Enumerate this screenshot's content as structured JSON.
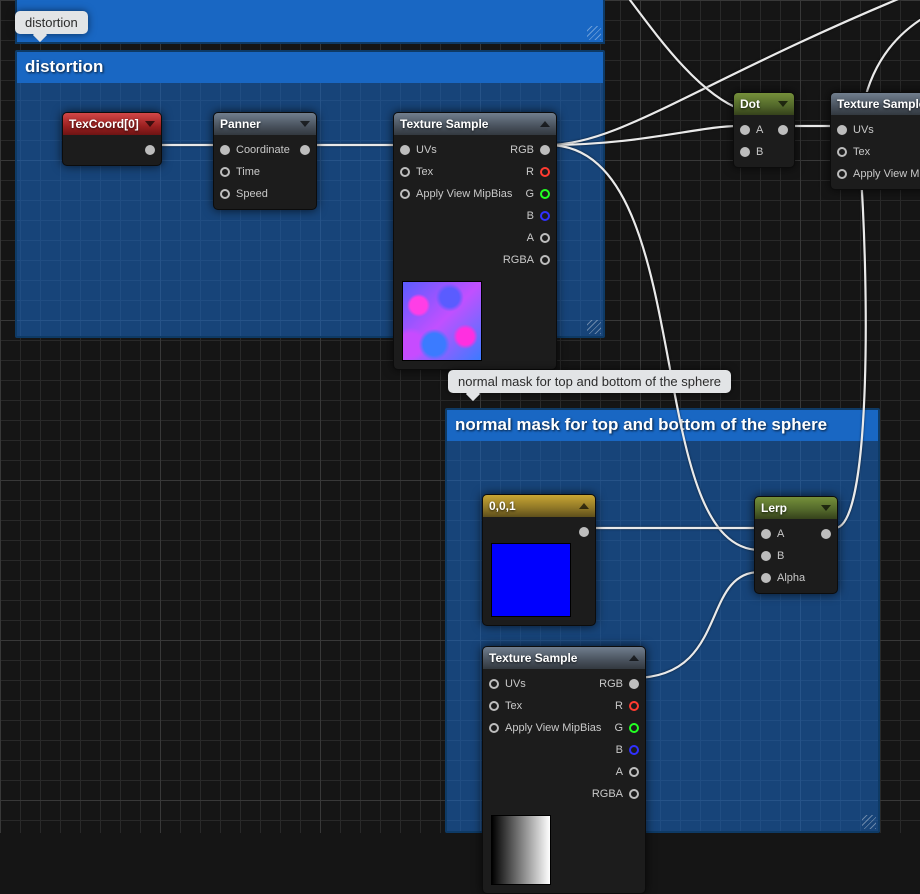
{
  "tooltips": {
    "distortion": "distortion",
    "mask": "normal mask for top and bottom of the sphere"
  },
  "comments": {
    "distortion": "distortion",
    "mask": "normal mask for top and bottom of the sphere"
  },
  "nodes": {
    "texcoord": {
      "title": "TexCoord[0]"
    },
    "panner": {
      "title": "Panner",
      "in": [
        "Coordinate",
        "Time",
        "Speed"
      ]
    },
    "texsample": {
      "title": "Texture Sample",
      "in": [
        "UVs",
        "Tex",
        "Apply View MipBias"
      ],
      "out": [
        "RGB",
        "R",
        "G",
        "B",
        "A",
        "RGBA"
      ]
    },
    "dot": {
      "title": "Dot",
      "in": [
        "A",
        "B"
      ]
    },
    "texsample2": {
      "title": "Texture Sample",
      "in": [
        "UVs",
        "Tex",
        "Apply View MipBi"
      ]
    },
    "const3": {
      "title": "0,0,1"
    },
    "lerp": {
      "title": "Lerp",
      "in": [
        "A",
        "B",
        "Alpha"
      ]
    },
    "texsample3": {
      "title": "Texture Sample",
      "in": [
        "UVs",
        "Tex",
        "Apply View MipBias"
      ],
      "out": [
        "RGB",
        "R",
        "G",
        "B",
        "A",
        "RGBA"
      ]
    }
  }
}
